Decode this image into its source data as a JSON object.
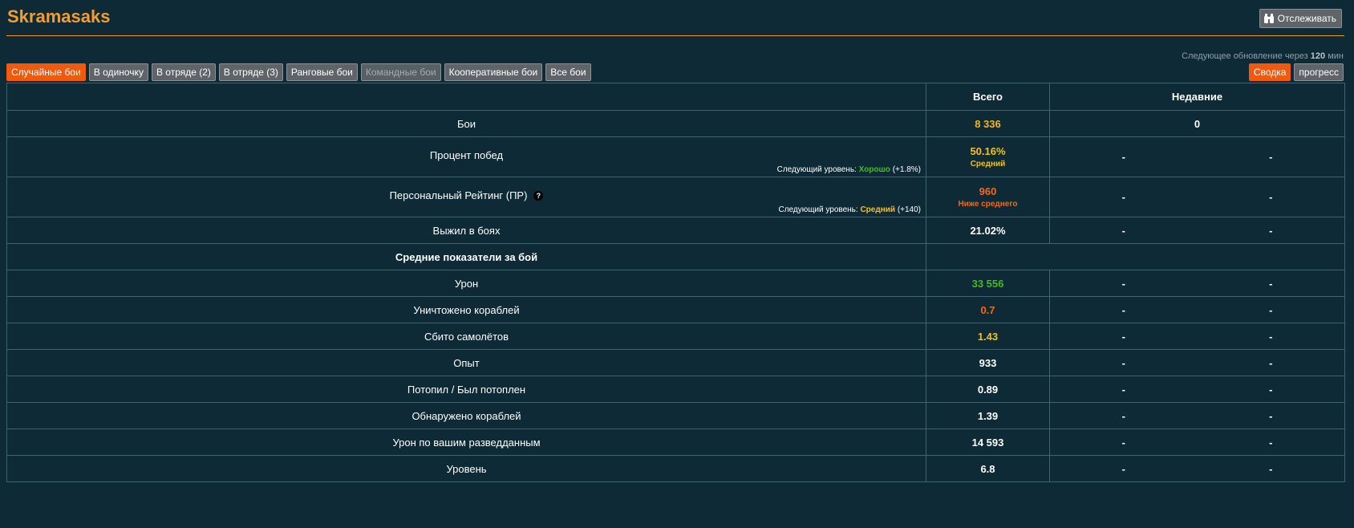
{
  "header": {
    "player_name": "Skramasaks",
    "track_button": "Отслеживать"
  },
  "update_note": {
    "prefix": "Следующее обновление через",
    "value": "120",
    "suffix": "мин"
  },
  "tabs": [
    {
      "label": "Случайные бои",
      "state": "active"
    },
    {
      "label": "В одиночку",
      "state": "normal"
    },
    {
      "label": "В отряде (2)",
      "state": "normal"
    },
    {
      "label": "В отряде (3)",
      "state": "normal"
    },
    {
      "label": "Ранговые бои",
      "state": "normal"
    },
    {
      "label": "Командные бои",
      "state": "disabled"
    },
    {
      "label": "Кооперативные бои",
      "state": "normal"
    },
    {
      "label": "Все бои",
      "state": "normal"
    }
  ],
  "views": [
    {
      "label": "Сводка",
      "state": "active"
    },
    {
      "label": "прогресс",
      "state": "normal"
    }
  ],
  "table": {
    "col_total": "Всего",
    "col_recent": "Недавние",
    "battles": {
      "label": "Бои",
      "total": "8 336",
      "total_color": "#f2b41e",
      "recent": "0"
    },
    "winrate": {
      "label": "Процент побед",
      "total": "50.16%",
      "total_color": "#f2c21b",
      "rating": "Средний",
      "rating_color": "#f2c21b",
      "next_prefix": "Следующий уровень:",
      "next_level": "Хорошо",
      "next_color": "#46bd1c",
      "next_delta": "(+1.8%)",
      "recent_a": "-",
      "recent_b": "-"
    },
    "pr": {
      "label": "Персональный Рейтинг (ПР)",
      "help_icon": "question-circle-icon",
      "help_glyph": "?",
      "total": "960",
      "total_color": "#f06a1a",
      "rating": "Ниже среднего",
      "rating_color": "#f06a1a",
      "next_prefix": "Следующий уровень:",
      "next_level": "Средний",
      "next_color": "#f2c21b",
      "next_delta": "(+140)",
      "recent_a": "-",
      "recent_b": "-"
    },
    "survived": {
      "label": "Выжил в боях",
      "total": "21.02%",
      "recent_a": "-",
      "recent_b": "-"
    },
    "section_title": "Средние показатели за бой",
    "rows": [
      {
        "label": "Урон",
        "total": "33 556",
        "color": "#47b81f",
        "recent_a": "-",
        "recent_b": "-"
      },
      {
        "label": "Уничтожено кораблей",
        "total": "0.7",
        "color": "#f06a1a",
        "recent_a": "-",
        "recent_b": "-"
      },
      {
        "label": "Сбито самолётов",
        "total": "1.43",
        "color": "#f2c21b",
        "recent_a": "-",
        "recent_b": "-"
      },
      {
        "label": "Опыт",
        "total": "933",
        "color": "#ffffff",
        "recent_a": "-",
        "recent_b": "-"
      },
      {
        "label": "Потопил / Был потоплен",
        "total": "0.89",
        "color": "#ffffff",
        "recent_a": "-",
        "recent_b": "-"
      },
      {
        "label": "Обнаружено кораблей",
        "total": "1.39",
        "color": "#ffffff",
        "recent_a": "-",
        "recent_b": "-"
      },
      {
        "label": "Урон по вашим разведданным",
        "total": "14 593",
        "color": "#ffffff",
        "recent_a": "-",
        "recent_b": "-"
      },
      {
        "label": "Уровень",
        "total": "6.8",
        "color": "#ffffff",
        "recent_a": "-",
        "recent_b": "-"
      }
    ]
  }
}
